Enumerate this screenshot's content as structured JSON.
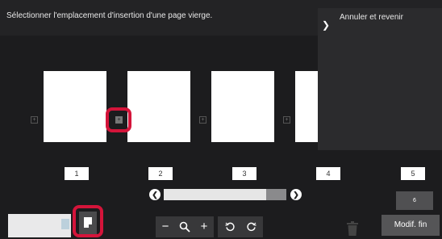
{
  "header": {
    "instruction": "Sélectionner l'emplacement d'insertion d'une page vierge."
  },
  "menu": {
    "toggle_glyph": "❯",
    "return_label": "Annuler et revenir"
  },
  "pages": [
    {
      "label": "1"
    },
    {
      "label": "2"
    },
    {
      "label": "3"
    },
    {
      "label": "4"
    },
    {
      "label": "5"
    }
  ],
  "insertion_points": {
    "glyph": "+",
    "selected_index": 1
  },
  "scroll": {
    "left_glyph": "❮",
    "right_glyph": "❯",
    "position_fraction": 0.84
  },
  "total_pages": "6",
  "toolbar": {
    "zoom_out": "−",
    "zoom_in": "+",
    "icons": [
      "blank-page-icon",
      "search-icon",
      "rotate-left-icon",
      "rotate-right-icon",
      "trash-icon"
    ]
  },
  "finish_label": "Modif. fin",
  "colors": {
    "selection_ring": "#d4143a",
    "background": "#1c1c1e"
  }
}
